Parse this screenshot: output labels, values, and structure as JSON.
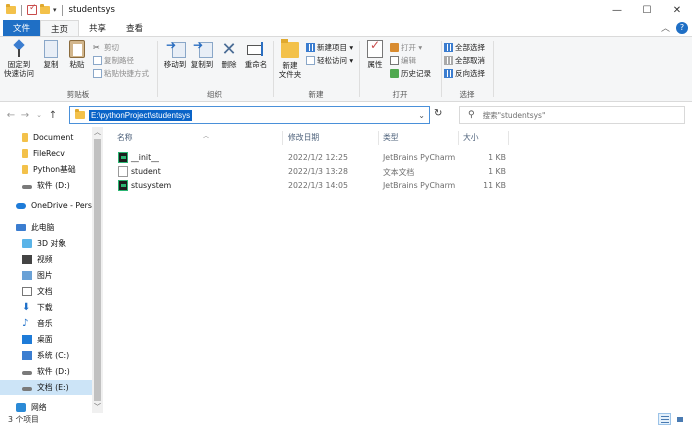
{
  "window": {
    "title": "studentsys",
    "minimize": "—",
    "maximize": "☐",
    "close": "✕"
  },
  "ribbon_tabs": [
    "文件",
    "主页",
    "共享",
    "查看"
  ],
  "ribbon": {
    "clipboard": {
      "pin": "固定到\n快速访问",
      "copy": "复制",
      "paste": "粘贴",
      "cut": "剪切",
      "copy_path": "复制路径",
      "paste_shortcut": "粘贴快捷方式",
      "label": "剪贴板"
    },
    "organize": {
      "move_to": "移动到",
      "copy_to": "复制到",
      "delete": "删除",
      "rename": "重命名",
      "label": "组织"
    },
    "new": {
      "new_item": "新建项目 ▾",
      "easy_access": "轻松访问 ▾",
      "new_folder": "新建\n文件夹",
      "label": "新建"
    },
    "open": {
      "properties": "属性",
      "open": "打开 ▾",
      "edit": "编辑",
      "history": "历史记录",
      "label": "打开"
    },
    "select": {
      "select_all": "全部选择",
      "select_none": "全部取消",
      "invert": "反向选择",
      "label": "选择"
    }
  },
  "address": {
    "path": "E:\\pythonProject\\studentsys",
    "search_placeholder": "搜索\"studentsys\""
  },
  "nav_pane": [
    {
      "label": "Document",
      "icon": "folder-icon"
    },
    {
      "label": "FileRecv",
      "icon": "folder-icon"
    },
    {
      "label": "Python基础",
      "icon": "folder-icon"
    },
    {
      "label": "软件 (D:)",
      "icon": "drive-icon"
    },
    {
      "label": "OneDrive - Persc",
      "icon": "onedrive-icon"
    },
    {
      "label": "此电脑",
      "icon": "computer-icon"
    },
    {
      "label": "3D 对象",
      "icon": "3d-objects-icon"
    },
    {
      "label": "视频",
      "icon": "video-icon"
    },
    {
      "label": "图片",
      "icon": "pictures-icon"
    },
    {
      "label": "文档",
      "icon": "documents-icon"
    },
    {
      "label": "下载",
      "icon": "downloads-icon"
    },
    {
      "label": "音乐",
      "icon": "music-icon"
    },
    {
      "label": "桌面",
      "icon": "desktop-icon"
    },
    {
      "label": "系统 (C:)",
      "icon": "system-drive-icon"
    },
    {
      "label": "软件 (D:)",
      "icon": "drive-icon"
    },
    {
      "label": "文档 (E:)",
      "icon": "drive-icon"
    },
    {
      "label": "网络",
      "icon": "network-icon"
    }
  ],
  "columns": {
    "name": "名称",
    "date": "修改日期",
    "type": "类型",
    "size": "大小"
  },
  "files": [
    {
      "name": "__init__",
      "date": "2022/1/2 12:25",
      "type": "JetBrains PyCharm",
      "size": "1 KB",
      "icon": "pycharm-file-icon"
    },
    {
      "name": "student",
      "date": "2022/1/3 13:28",
      "type": "文本文档",
      "size": "1 KB",
      "icon": "text-file-icon"
    },
    {
      "name": "stusystem",
      "date": "2022/1/3 14:05",
      "type": "JetBrains PyCharm",
      "size": "11 KB",
      "icon": "pycharm-file-icon"
    }
  ],
  "status": {
    "item_count": "3 个项目"
  },
  "colors": {
    "accent": "#1f6fc5",
    "selection": "#cce4f7",
    "address_highlight": "#0a64c8"
  }
}
